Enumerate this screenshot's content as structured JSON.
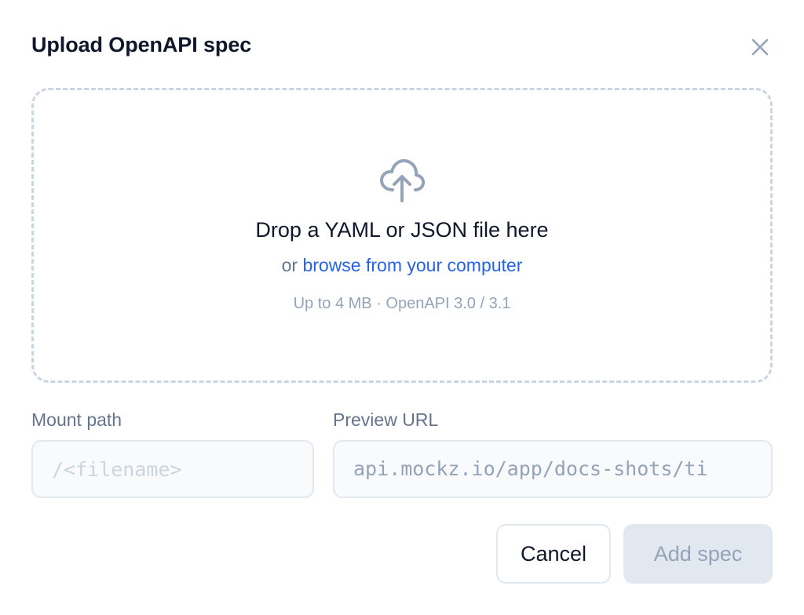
{
  "dialog": {
    "title": "Upload OpenAPI spec",
    "close_icon": "close-icon"
  },
  "dropzone": {
    "icon": "cloud-upload-icon",
    "title": "Drop a YAML or JSON file here",
    "sub_prefix": "or",
    "browse_link": "browse from your computer",
    "hint": "Up to 4 MB · OpenAPI 3.0 / 3.1"
  },
  "fields": {
    "mount_path": {
      "label": "Mount path",
      "value": "",
      "placeholder": "/<filename>"
    },
    "preview_url": {
      "label": "Preview URL",
      "value": "api.mockz.io/app/docs-shots/ti"
    }
  },
  "actions": {
    "cancel_label": "Cancel",
    "add_label": "Add spec"
  },
  "colors": {
    "link": "#2563eb",
    "text_primary": "#0f172a",
    "text_muted": "#64748b",
    "border_dashed": "#cbd5e1",
    "button_disabled_bg": "#e2e8f0"
  }
}
